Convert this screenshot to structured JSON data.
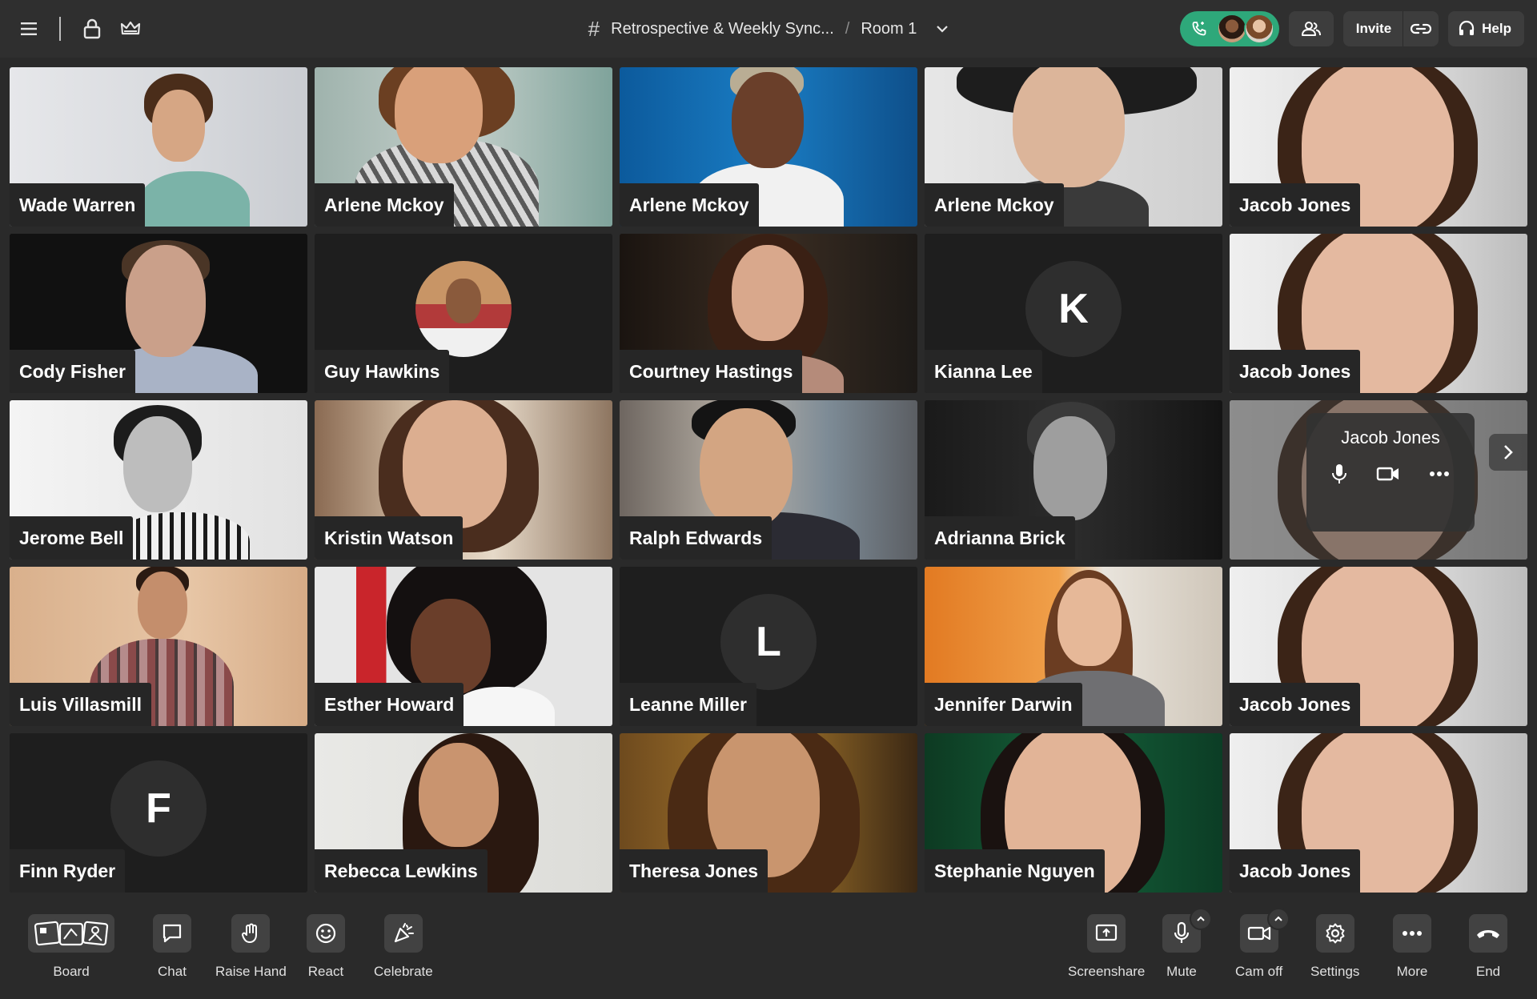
{
  "topbar": {
    "title": "Retrospective & Weekly Sync...",
    "room": "Room 1",
    "invite_label": "Invite",
    "help_label": "Help"
  },
  "tiles": [
    {
      "name": "Wade Warren"
    },
    {
      "name": "Arlene Mckoy"
    },
    {
      "name": "Arlene Mckoy"
    },
    {
      "name": "Arlene Mckoy"
    },
    {
      "name": "Jacob Jones"
    },
    {
      "name": "Cody Fisher"
    },
    {
      "name": "Guy Hawkins"
    },
    {
      "name": "Courtney Hastings"
    },
    {
      "name": "Kianna Lee",
      "initial": "K"
    },
    {
      "name": "Jacob Jones"
    },
    {
      "name": "Jerome Bell"
    },
    {
      "name": "Kristin Watson"
    },
    {
      "name": "Ralph Edwards"
    },
    {
      "name": "Adrianna Brick"
    },
    {
      "name": "Jacob Jones"
    },
    {
      "name": "Luis Villasmill"
    },
    {
      "name": "Esther Howard"
    },
    {
      "name": "Leanne Miller",
      "initial": "L"
    },
    {
      "name": "Jennifer Darwin"
    },
    {
      "name": "Jacob Jones"
    },
    {
      "name": "Finn Ryder",
      "initial": "F"
    },
    {
      "name": "Rebecca Lewkins"
    },
    {
      "name": "Theresa Jones"
    },
    {
      "name": "Stephanie Nguyen"
    },
    {
      "name": "Jacob Jones"
    }
  ],
  "bottombar": {
    "left": [
      {
        "label": "Board",
        "icon": "board-icon"
      },
      {
        "label": "Chat",
        "icon": "chat-icon"
      },
      {
        "label": "Raise Hand",
        "icon": "raise-hand-icon"
      },
      {
        "label": "React",
        "icon": "smiley-icon"
      },
      {
        "label": "Celebrate",
        "icon": "party-popper-icon"
      }
    ],
    "right": [
      {
        "label": "Screenshare",
        "icon": "screenshare-icon"
      },
      {
        "label": "Mute",
        "icon": "microphone-icon"
      },
      {
        "label": "Cam off",
        "icon": "camera-icon"
      },
      {
        "label": "Settings",
        "icon": "gear-icon"
      },
      {
        "label": "More",
        "icon": "more-icon"
      },
      {
        "label": "End",
        "icon": "hang-up-icon"
      }
    ]
  },
  "colors": {
    "background": "#2a2a2a",
    "topbar": "#2f2f2f",
    "call_pill": "#2ea87a",
    "end_call": "#ffffff"
  }
}
